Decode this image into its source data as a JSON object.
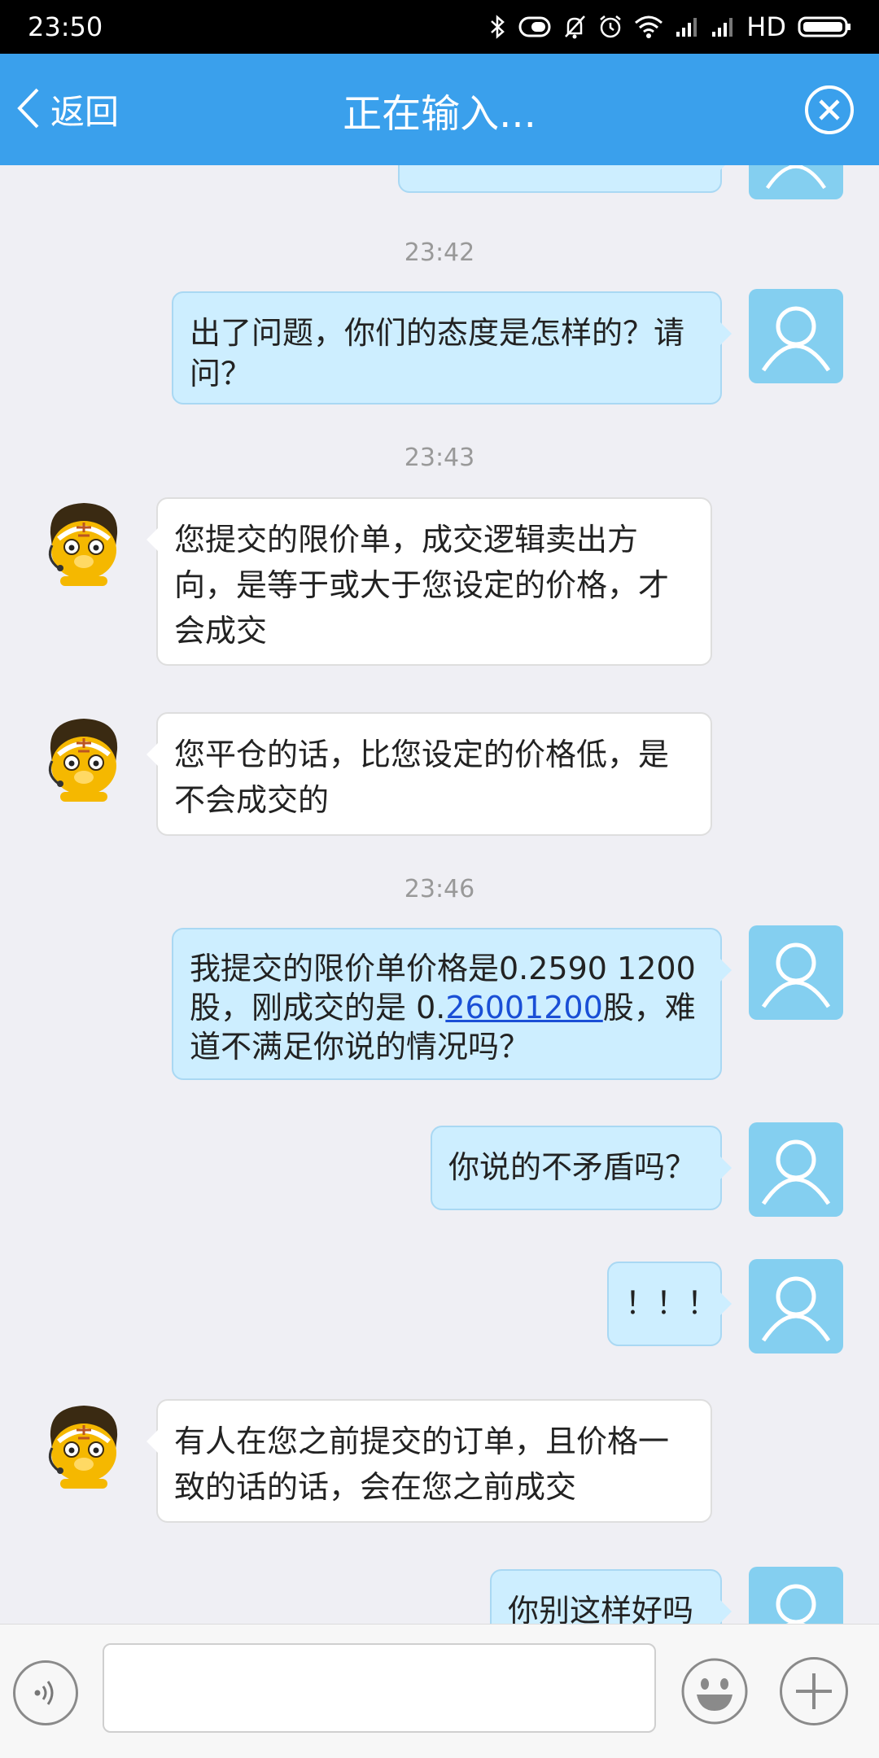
{
  "status_bar": {
    "time": "23:50",
    "network_label": "HD",
    "icons": [
      "bluetooth-icon",
      "vibrate-icon",
      "mute-icon",
      "alarm-icon",
      "wifi-icon",
      "signal-icon",
      "signal-icon",
      "battery-icon"
    ]
  },
  "header": {
    "back_label": "返回",
    "title": "正在输入...",
    "close_icon": "close-circle-icon",
    "bar_color": "#3aa0ec"
  },
  "chat": {
    "timestamps": [
      "23:42",
      "23:43",
      "23:46"
    ],
    "messages": [
      {
        "from": "user",
        "text": "出了问题，你们的态度是怎样的？请问？"
      },
      {
        "from": "agent",
        "text": "您提交的限价单，成交逻辑卖出方向，是等于或大于您设定的价格，才会成交"
      },
      {
        "from": "agent",
        "text": "您平仓的话，比您设定的价格低，是不会成交的"
      },
      {
        "from": "user",
        "text_before": "我提交的限价单价格是0.2590 1200股，刚成交的是 0.",
        "link": "26001200",
        "text_after": "股，难道不满足你说的情况吗？"
      },
      {
        "from": "user",
        "text": "你说的不矛盾吗？"
      },
      {
        "from": "user",
        "text": "！！！"
      },
      {
        "from": "agent",
        "text": "有人在您之前提交的订单，且价格一致的话的话，会在您之前成交"
      },
      {
        "from": "user",
        "text": "你别这样好吗"
      }
    ],
    "user_bubble_color": "#cdeeff",
    "agent_bubble_color": "#ffffff"
  },
  "input_bar": {
    "value": "",
    "icons": [
      "voice-icon",
      "emoji-icon",
      "plus-icon"
    ]
  }
}
